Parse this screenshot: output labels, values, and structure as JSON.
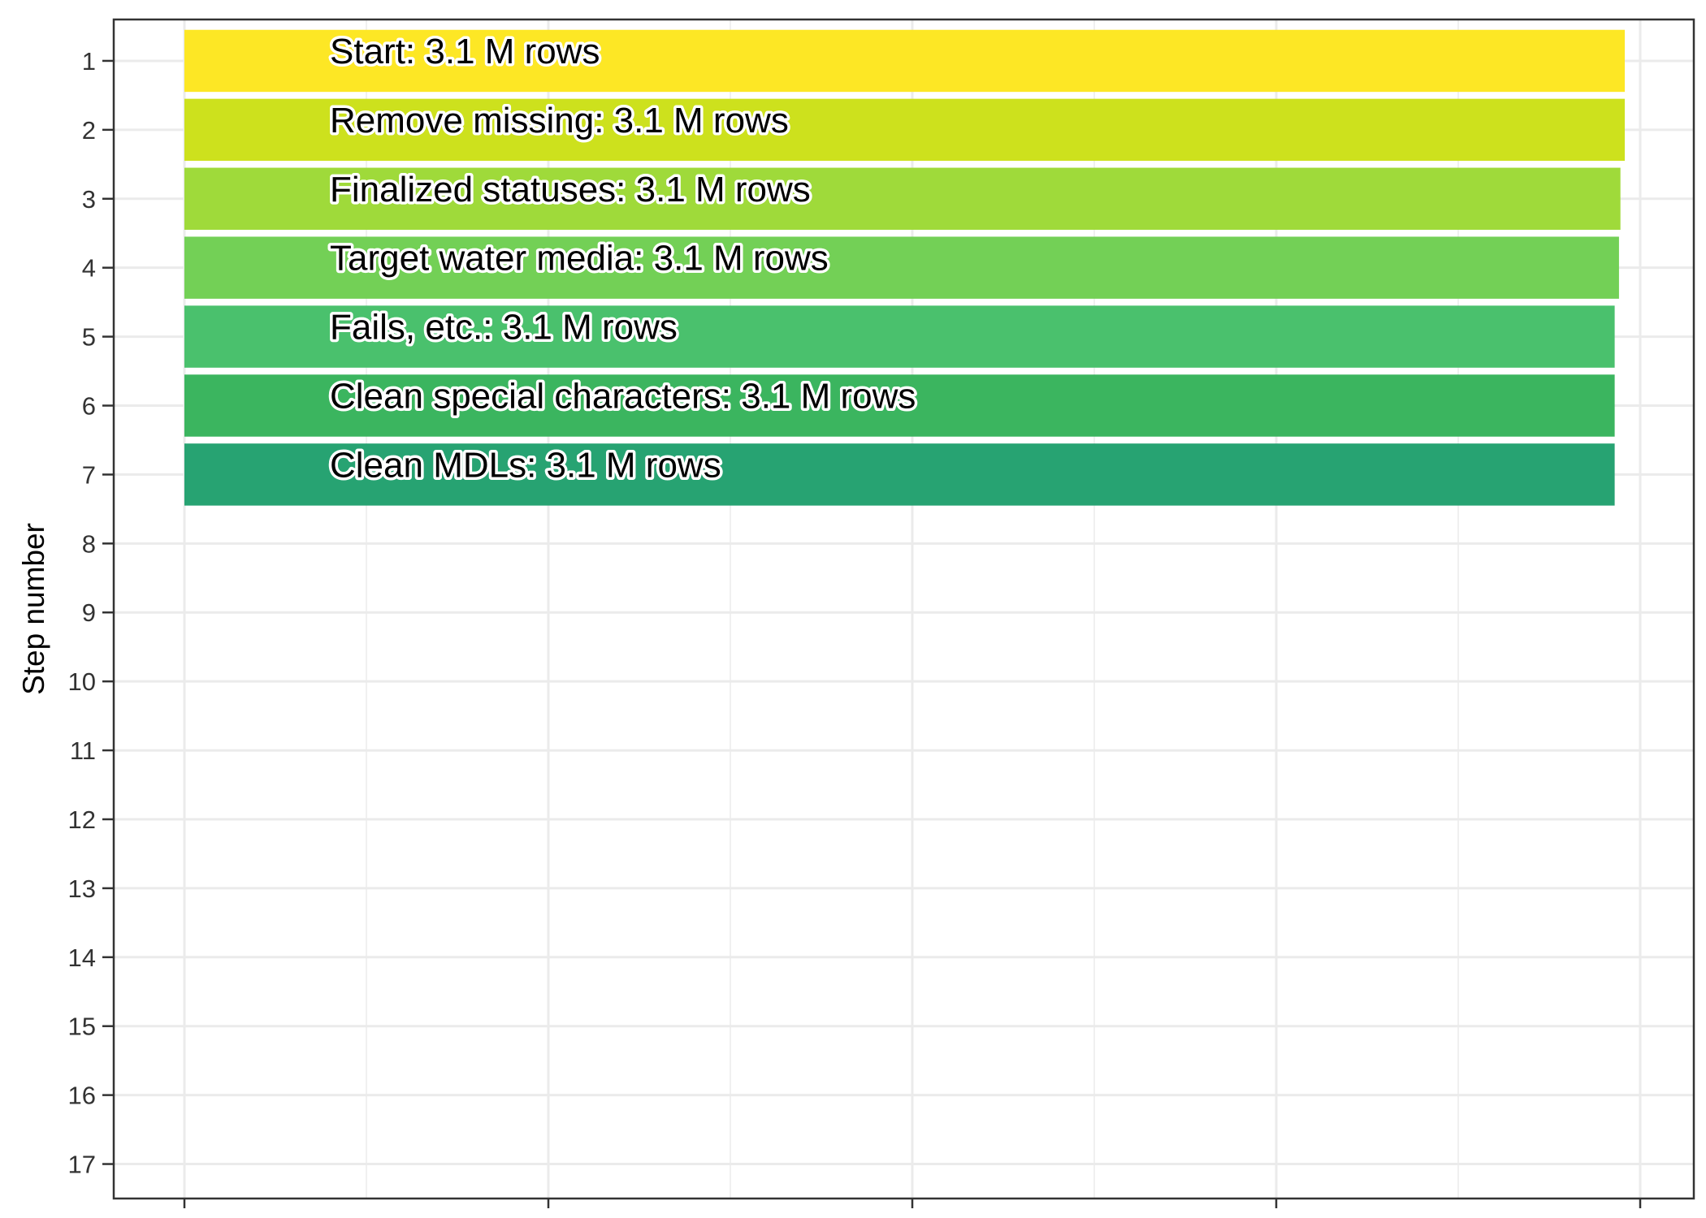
{
  "chart_data": {
    "type": "bar",
    "orientation": "horizontal",
    "categories": [
      1,
      2,
      3,
      4,
      5,
      6,
      7
    ],
    "labels": [
      "Start:  3.1 M rows",
      "Remove missing:  3.1 M rows",
      "Finalized statuses:  3.1 M rows",
      "Target water media:  3.1 M rows",
      "Fails, etc.:  3.1 M rows",
      "Clean special characters:  3.1 M rows",
      "Clean MDLs:  3.1 M rows"
    ],
    "values": [
      3.1,
      3.1,
      3.1,
      3.1,
      3.1,
      3.1,
      3.1
    ],
    "relative_lengths": [
      1.0,
      1.0,
      0.997,
      0.996,
      0.993,
      0.993,
      0.993
    ],
    "colors": [
      "#FDE725",
      "#CDE11D",
      "#9FDA3A",
      "#73D056",
      "#4AC16D",
      "#3BB55F",
      "#27A372"
    ],
    "y_ticks": [
      1,
      2,
      3,
      4,
      5,
      6,
      7,
      8,
      9,
      10,
      11,
      12,
      13,
      14,
      15,
      16,
      17
    ],
    "ylim": [
      0.4,
      17.5
    ],
    "ylabel": "Step number",
    "xlabel": "",
    "title": "",
    "grid": true,
    "legend": "none"
  }
}
